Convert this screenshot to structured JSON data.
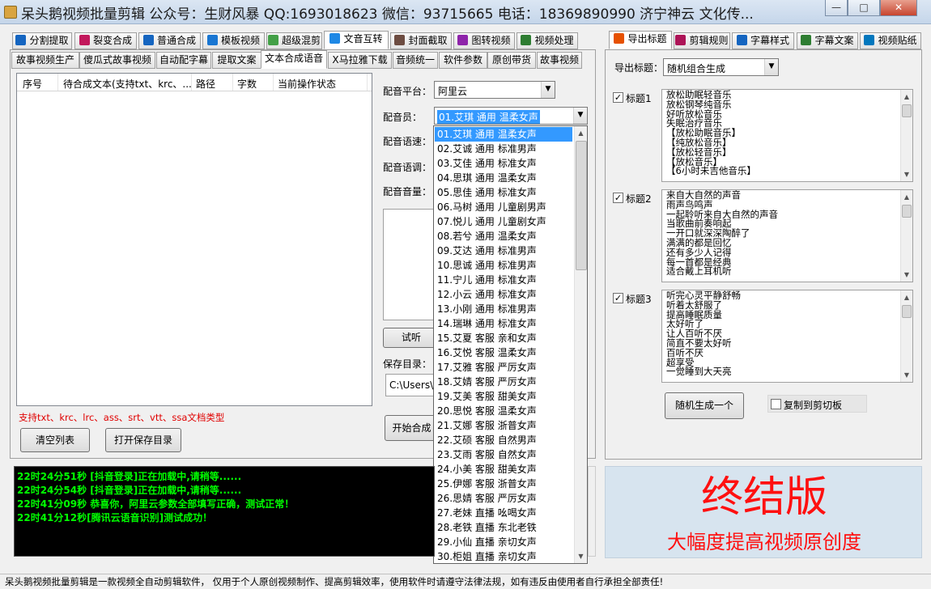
{
  "window": {
    "title": "呆头鹅视频批量剪辑 公众号：生财风暴 QQ:1693018623 微信：93715665 电话：18369890990 济宁神云 文化传...",
    "btn_min": "—",
    "btn_max": "□",
    "btn_close": "✕"
  },
  "main_tabs": [
    {
      "label": "分割提取",
      "icon": "play-icon"
    },
    {
      "label": "裂变合成",
      "icon": "split-icon"
    },
    {
      "label": "普通合成",
      "icon": "play-icon"
    },
    {
      "label": "模板视频",
      "icon": "template-icon"
    },
    {
      "label": "超级混剪",
      "icon": "mix-icon"
    },
    {
      "label": "文音互转",
      "icon": "microphone-icon"
    },
    {
      "label": "封面截取",
      "icon": "image-icon"
    },
    {
      "label": "图转视频",
      "icon": "picture-icon"
    },
    {
      "label": "视频处理",
      "icon": "video-icon"
    }
  ],
  "sub_tabs": [
    "故事视频生产",
    "傻瓜式故事视频",
    "自动配字幕",
    "提取文案",
    "文本合成语音",
    "X马拉雅下载",
    "音频统一",
    "软件参数",
    "原创带货",
    "故事视频"
  ],
  "table": {
    "columns": [
      "序号",
      "待合成文本(支持txt、krc、...",
      "路径",
      "字数",
      "当前操作状态"
    ]
  },
  "supported_types": "支持txt、krc、lrc、ass、srt、vtt、ssa文档类型",
  "buttons": {
    "clear_list": "清空列表",
    "open_save_dir": "打开保存目录",
    "audition": "试听",
    "start_synthesis": "开始合成",
    "random_generate": "随机生成一个"
  },
  "voice": {
    "platform_label": "配音平台：",
    "platform_value": "阿里云",
    "speaker_label": "配音员：",
    "speaker_value": "01.艾琪 通用 温柔女声",
    "speed_label": "配音语速：",
    "pitch_label": "配音语调：",
    "volume_label": "配音音量：",
    "save_dir_label": "保存目录：",
    "save_dir_value": "C:\\Users\\"
  },
  "speakers": [
    "01.艾琪 通用 温柔女声",
    "02.艾诚 通用 标准男声",
    "03.艾佳 通用 标准女声",
    "04.思琪 通用 温柔女声",
    "05.思佳 通用 标准女声",
    "06.马树 通用 儿童剧男声",
    "07.悦儿 通用 儿童剧女声",
    "08.若兮 通用 温柔女声",
    "09.艾达 通用 标准男声",
    "10.思诚 通用 标准男声",
    "11.宁儿 通用 标准女声",
    "12.小云 通用 标准女声",
    "13.小刚 通用 标准男声",
    "14.瑞琳 通用 标准女声",
    "15.艾夏 客服 亲和女声",
    "16.艾悦 客服 温柔女声",
    "17.艾雅 客服 严厉女声",
    "18.艾婧 客服 严厉女声",
    "19.艾美 客服 甜美女声",
    "20.思悦 客服 温柔女声",
    "21.艾娜 客服 浙普女声",
    "22.艾硕 客服 自然男声",
    "23.艾雨 客服 自然女声",
    "24.小美 客服 甜美女声",
    "25.伊娜 客服 浙普女声",
    "26.思婧 客服 严厉女声",
    "27.老妹 直播 吆喝女声",
    "28.老铁 直播 东北老铁",
    "29.小仙 直播 亲切女声",
    "30.柜姐 直播 亲切女声"
  ],
  "log_lines": [
    "22时24分51秒 [抖音登录]正在加载中,请稍等......",
    "22时24分54秒 [抖音登录]正在加载中,请稍等......",
    "22时41分09秒 恭喜你，阿里云参数全部填写正确，测试正常！",
    "22时41分12秒[腾讯云语音识别]测试成功！"
  ],
  "right_tabs": [
    {
      "label": "导出标题",
      "icon": "export-icon"
    },
    {
      "label": "剪辑规则",
      "icon": "rule-icon"
    },
    {
      "label": "字幕样式",
      "icon": "subtitle-icon"
    },
    {
      "label": "字幕文案",
      "icon": "edit-icon"
    },
    {
      "label": "视频贴纸",
      "icon": "sticker-icon"
    }
  ],
  "export": {
    "label": "导出标题：",
    "mode": "随机组合生成",
    "copy_clipboard": "复制到剪切板"
  },
  "title_groups": [
    {
      "label": "标题1",
      "checked": true,
      "lines": [
        "放松助眠轻音乐",
        "放松钢琴纯音乐",
        "好听放松音乐",
        "失眠治疗音乐",
        "【放松助眠音乐】",
        "【纯放松音乐】",
        "【放松轻音乐】",
        "【放松音乐】",
        "【6小时未吉他音乐】"
      ]
    },
    {
      "label": "标题2",
      "checked": true,
      "lines": [
        "来自大自然的声音",
        "雨声鸟鸣声",
        "一起聆听来自大自然的声音",
        "当歌曲前奏响起",
        "一开口就深深陶醉了",
        "满满的都是回忆",
        "还有多少人记得",
        "每一首都是经典",
        "适合戴上耳机听"
      ]
    },
    {
      "label": "标题3",
      "checked": true,
      "lines": [
        "听完心灵平静舒畅",
        "听着太舒服了",
        "提高睡眠质量",
        "太好听了",
        "让人百听不厌",
        "简直不要太好听",
        "百听不厌",
        "超享受",
        "一觉睡到大天亮"
      ]
    }
  ],
  "promo": {
    "title": "终结版",
    "subtitle": "大幅度提高视频原创度",
    "color": "#ff1010"
  },
  "status_text": "呆头鹅视频批量剪辑是一款视频全自动剪辑软件， 仅用于个人原创视频制作、提高剪辑效率，使用软件时请遵守法律法规，如有违反由使用者自行承担全部责任!"
}
